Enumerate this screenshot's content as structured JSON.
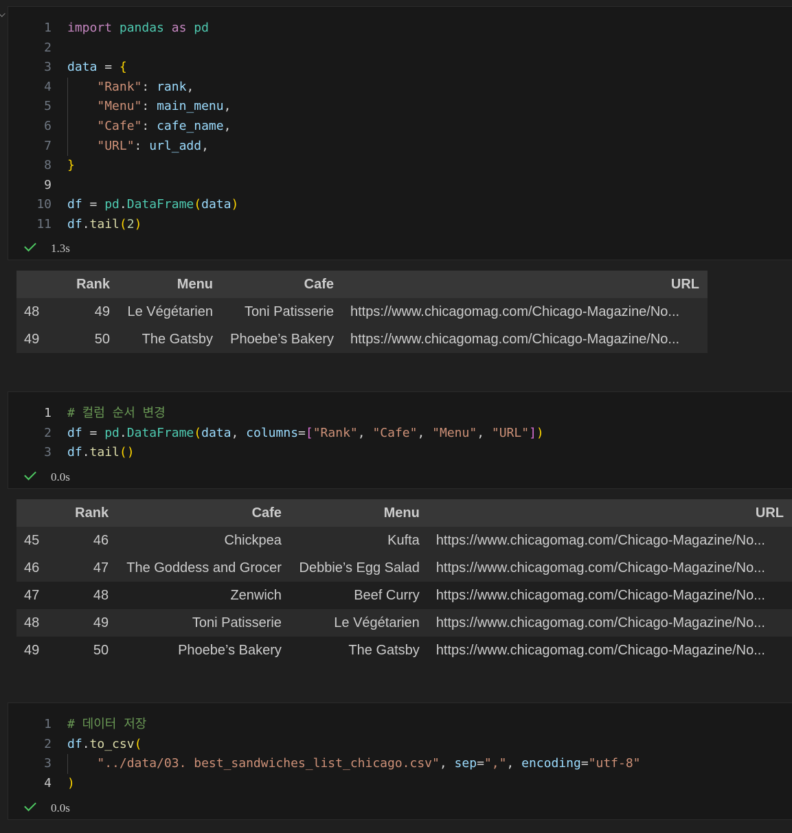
{
  "cell1": {
    "lines": [
      {
        "n": "1"
      },
      {
        "n": "2"
      },
      {
        "n": "3"
      },
      {
        "n": "4"
      },
      {
        "n": "5"
      },
      {
        "n": "6"
      },
      {
        "n": "7"
      },
      {
        "n": "8"
      },
      {
        "n": "9"
      },
      {
        "n": "10"
      },
      {
        "n": "11"
      }
    ],
    "tokens": {
      "import": "import",
      "pandas": "pandas",
      "as": "as",
      "pd": "pd",
      "data": "data",
      "eq": " = ",
      "lbrace": "{",
      "k_rank": "\"Rank\"",
      "v_rank": "rank",
      "k_menu": "\"Menu\"",
      "v_menu": "main_menu",
      "k_cafe": "\"Cafe\"",
      "v_cafe": "cafe_name",
      "k_url": "\"URL\"",
      "v_url": "url_add",
      "rbrace": "}",
      "df": "df",
      "pd2": "pd",
      "dataframe": "DataFrame",
      "data_arg": "data",
      "tail": "tail",
      "tail_arg": "2"
    },
    "status": "1.3s"
  },
  "table1": {
    "columns": [
      "",
      "Rank",
      "Menu",
      "Cafe",
      "URL"
    ],
    "rows": [
      [
        "48",
        "49",
        "Le Végétarien",
        "Toni Patisserie",
        "https://www.chicagomag.com/Chicago-Magazine/No..."
      ],
      [
        "49",
        "50",
        "The Gatsby",
        "Phoebe’s Bakery",
        "https://www.chicagomag.com/Chicago-Magazine/No..."
      ]
    ]
  },
  "cell2": {
    "lines": [
      {
        "n": "1"
      },
      {
        "n": "2"
      },
      {
        "n": "3"
      }
    ],
    "tokens": {
      "comment": "# 컬럼 순서 변경",
      "df": "df",
      "pd": "pd",
      "dataframe": "DataFrame",
      "data": "data",
      "columns": "columns",
      "c_rank": "\"Rank\"",
      "c_cafe": "\"Cafe\"",
      "c_menu": "\"Menu\"",
      "c_url": "\"URL\"",
      "tail": "tail"
    },
    "status": "0.0s"
  },
  "table2": {
    "columns": [
      "",
      "Rank",
      "Cafe",
      "Menu",
      "URL"
    ],
    "rows": [
      [
        "45",
        "46",
        "Chickpea",
        "Kufta",
        "https://www.chicagomag.com/Chicago-Magazine/No..."
      ],
      [
        "46",
        "47",
        "The Goddess and Grocer",
        "Debbie’s Egg Salad",
        "https://www.chicagomag.com/Chicago-Magazine/No..."
      ],
      [
        "47",
        "48",
        "Zenwich",
        "Beef Curry",
        "https://www.chicagomag.com/Chicago-Magazine/No..."
      ],
      [
        "48",
        "49",
        "Toni Patisserie",
        "Le Végétarien",
        "https://www.chicagomag.com/Chicago-Magazine/No..."
      ],
      [
        "49",
        "50",
        "Phoebe’s Bakery",
        "The Gatsby",
        "https://www.chicagomag.com/Chicago-Magazine/No..."
      ]
    ]
  },
  "cell3": {
    "lines": [
      {
        "n": "1"
      },
      {
        "n": "2"
      },
      {
        "n": "3"
      },
      {
        "n": "4"
      }
    ],
    "tokens": {
      "comment": "# 데이터 저장",
      "df": "df",
      "to_csv": "to_csv",
      "path": "\"../data/03. best_sandwiches_list_chicago.csv\"",
      "sep": "sep",
      "sep_val": "\",\"",
      "encoding": "encoding",
      "enc_val": "\"utf-8\""
    },
    "status": "0.0s"
  },
  "colors": {
    "background": "#1f1f1f",
    "cell": "#181818",
    "header": "#373737",
    "row_stripe": "#2b2b2b",
    "success": "#4ec962"
  }
}
